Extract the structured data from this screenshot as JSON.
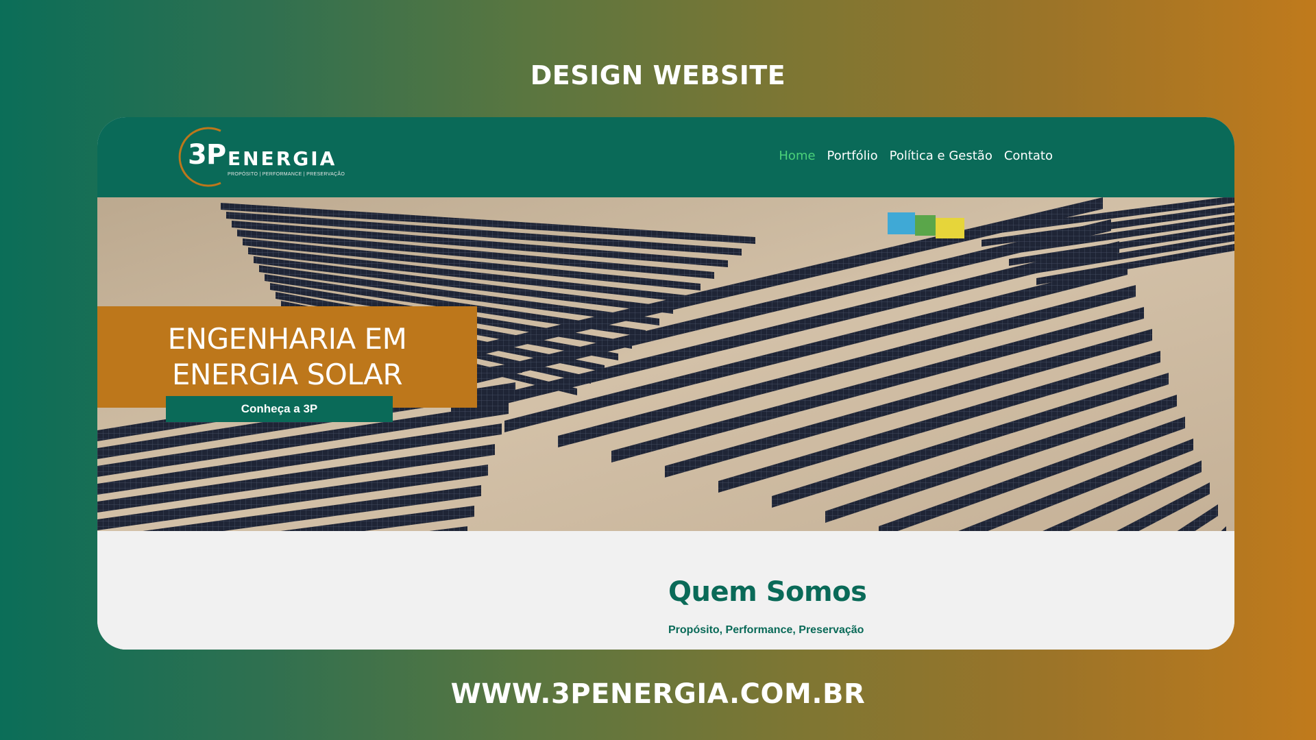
{
  "page": {
    "heading": "DESIGN WEBSITE",
    "footer_url": "WWW.3PENERGIA.COM.BR"
  },
  "site": {
    "logo": {
      "mark": "3P",
      "wordmark": "ENERGIA",
      "tagline": "PROPÓSITO | PERFORMANCE | PRESERVAÇÃO"
    },
    "nav": [
      {
        "label": "Home",
        "active": true
      },
      {
        "label": "Portfólio",
        "active": false
      },
      {
        "label": "Política e Gestão",
        "active": false
      },
      {
        "label": "Contato",
        "active": false
      }
    ],
    "hero": {
      "title_line1": "ENGENHARIA EM",
      "title_line2": "ENERGIA SOLAR",
      "cta_label": "Conheça a 3P",
      "image_description_icon": "solar-farm-aerial-image"
    },
    "about": {
      "title": "Quem Somos",
      "subtitle": "Propósito, Performance, Preservação"
    }
  },
  "colors": {
    "brand_green": "#0a6a58",
    "brand_orange": "#bd771b",
    "nav_active": "#4cd27a",
    "gradient_start": "#0b6e58",
    "gradient_end": "#c07a1c"
  }
}
